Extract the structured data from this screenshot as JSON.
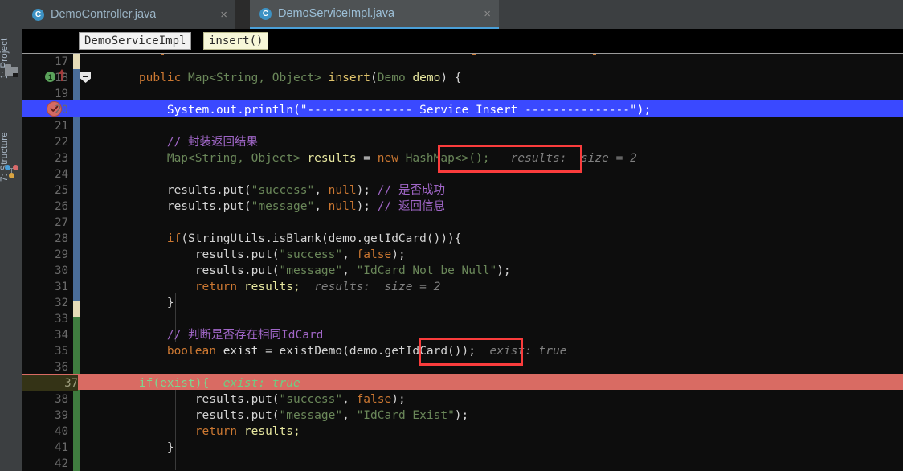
{
  "window": {
    "ide": "IntelliJ IDEA",
    "theme_bg": "#0d0d0d",
    "accent": "#4a9fd8"
  },
  "toolstrip": {
    "tabs": [
      {
        "label": "1: Project",
        "icon": "folder-icon"
      },
      {
        "label": "7: Structure",
        "icon": "structure-icon"
      }
    ]
  },
  "tabs": [
    {
      "label": "DemoController.java",
      "icon": "java-class-icon",
      "badge": "C",
      "close": "×",
      "active": false
    },
    {
      "label": "DemoServiceImpl.java",
      "icon": "java-class-icon",
      "badge": "C",
      "close": "×",
      "active": true
    }
  ],
  "breadcrumb": {
    "class": "DemoServiceImpl",
    "method": "insert()"
  },
  "gutter": {
    "usage_count": "1",
    "usage_icon": "usage-marker-icon",
    "breakpoint_icon": "breakpoint-verified-icon",
    "fold_icon": "code-fold-icon",
    "vcs_colors": {
      "modified": "#4a6d99",
      "added": "#3f7d3f",
      "changed": "#e6dcb8"
    }
  },
  "editor": {
    "first_line": 17,
    "last_line": 42,
    "current_execution_line": 20,
    "caret_line": 37,
    "lines": [
      {
        "n": 17,
        "text": ""
      },
      {
        "n": 18,
        "text": "    public Map<String, Object> insert(Demo demo) {"
      },
      {
        "n": 19,
        "text": ""
      },
      {
        "n": 20,
        "text": "        System.out.println(\"--------------- Service Insert ---------------\");"
      },
      {
        "n": 21,
        "text": ""
      },
      {
        "n": 22,
        "text": "        // 封装返回结果"
      },
      {
        "n": 23,
        "text": "        Map<String, Object> results = new HashMap<>();"
      },
      {
        "n": 24,
        "text": ""
      },
      {
        "n": 25,
        "text": "        results.put(\"success\", null); // 是否成功"
      },
      {
        "n": 26,
        "text": "        results.put(\"message\", null); // 返回信息"
      },
      {
        "n": 27,
        "text": ""
      },
      {
        "n": 28,
        "text": "        if(StringUtils.isBlank(demo.getIdCard())){"
      },
      {
        "n": 29,
        "text": "            results.put(\"success\", false);"
      },
      {
        "n": 30,
        "text": "            results.put(\"message\", \"IdCard Not be Null\");"
      },
      {
        "n": 31,
        "text": "            return results;"
      },
      {
        "n": 32,
        "text": "        }"
      },
      {
        "n": 33,
        "text": ""
      },
      {
        "n": 34,
        "text": "        // 判断是否存在相同IdCard"
      },
      {
        "n": 35,
        "text": "        boolean exist = existDemo(demo.getIdCard());"
      },
      {
        "n": 36,
        "text": ""
      },
      {
        "n": 37,
        "text": "    if(exist){"
      },
      {
        "n": 38,
        "text": "            results.put(\"success\", false);"
      },
      {
        "n": 39,
        "text": "            results.put(\"message\", \"IdCard Exist\");"
      },
      {
        "n": 40,
        "text": "            return results;"
      },
      {
        "n": 41,
        "text": "        }"
      },
      {
        "n": 42,
        "text": ""
      }
    ],
    "inline_hints": [
      {
        "line": 23,
        "text": "results:  size = 2",
        "style": "gray-italic",
        "boxed": true
      },
      {
        "line": 31,
        "text": "results:  size = 2",
        "style": "gray-italic",
        "boxed": false
      },
      {
        "line": 35,
        "text": "exist: true",
        "style": "gray-italic",
        "boxed": true
      },
      {
        "line": 37,
        "text": "exist: true",
        "style": "green-italic",
        "boxed": false
      }
    ],
    "tokens": {
      "l18": {
        "kw": "public",
        "type": "Map<String, Object>",
        "method": "insert",
        "param_type": "Demo",
        "param_name": "demo",
        "brace": "{"
      },
      "l20": {
        "call": "System.out.println(",
        "string": "\"--------------- Service Insert ---------------\"",
        "end": ");"
      },
      "l22": {
        "comment": "// 封装返回结果"
      },
      "l23": {
        "type": "Map<String, Object>",
        "var": "results",
        "eq": "=",
        "kw": "new",
        "ctor": "HashMap<>();"
      },
      "l25": {
        "call": "results.put(",
        "key": "\"success\"",
        "val": "null",
        "end": ");",
        "comment": "// 是否成功"
      },
      "l26": {
        "call": "results.put(",
        "key": "\"message\"",
        "val": "null",
        "end": ");",
        "comment": "// 返回信息"
      },
      "l28": {
        "kw": "if",
        "expr": "(StringUtils.isBlank(demo.getIdCard())){"
      },
      "l29": {
        "call": "results.put(",
        "key": "\"success\"",
        "val": "false",
        "end": ");"
      },
      "l30": {
        "call": "results.put(",
        "key": "\"message\"",
        "val": "\"IdCard Not be Null\"",
        "end": ");"
      },
      "l31": {
        "kw": "return",
        "var": "results;"
      },
      "l34": {
        "comment": "// 判断是否存在相同IdCard"
      },
      "l35": {
        "kw": "boolean",
        "var": "exist",
        "eq": "=",
        "call": "existDemo(demo.getIdCard());"
      },
      "l37": {
        "kw": "if",
        "expr": "(exist){"
      },
      "l38": {
        "call": "results.put(",
        "key": "\"success\"",
        "val": "false",
        "end": ");"
      },
      "l39": {
        "call": "results.put(",
        "key": "\"message\"",
        "val": "\"IdCard Exist\"",
        "end": ");"
      },
      "l40": {
        "kw": "return",
        "var": "results;"
      }
    },
    "highlights": {
      "execution_row_color": "#3a49ff",
      "caret_row_color": "#d96b63",
      "caret_line_number_bg": "#343316"
    }
  },
  "annotations": {
    "box_color": "#fa3c3c",
    "boxes": [
      {
        "target": "results-size-hint",
        "line": 23
      },
      {
        "target": "exist-true-hint",
        "line": 35
      }
    ]
  }
}
